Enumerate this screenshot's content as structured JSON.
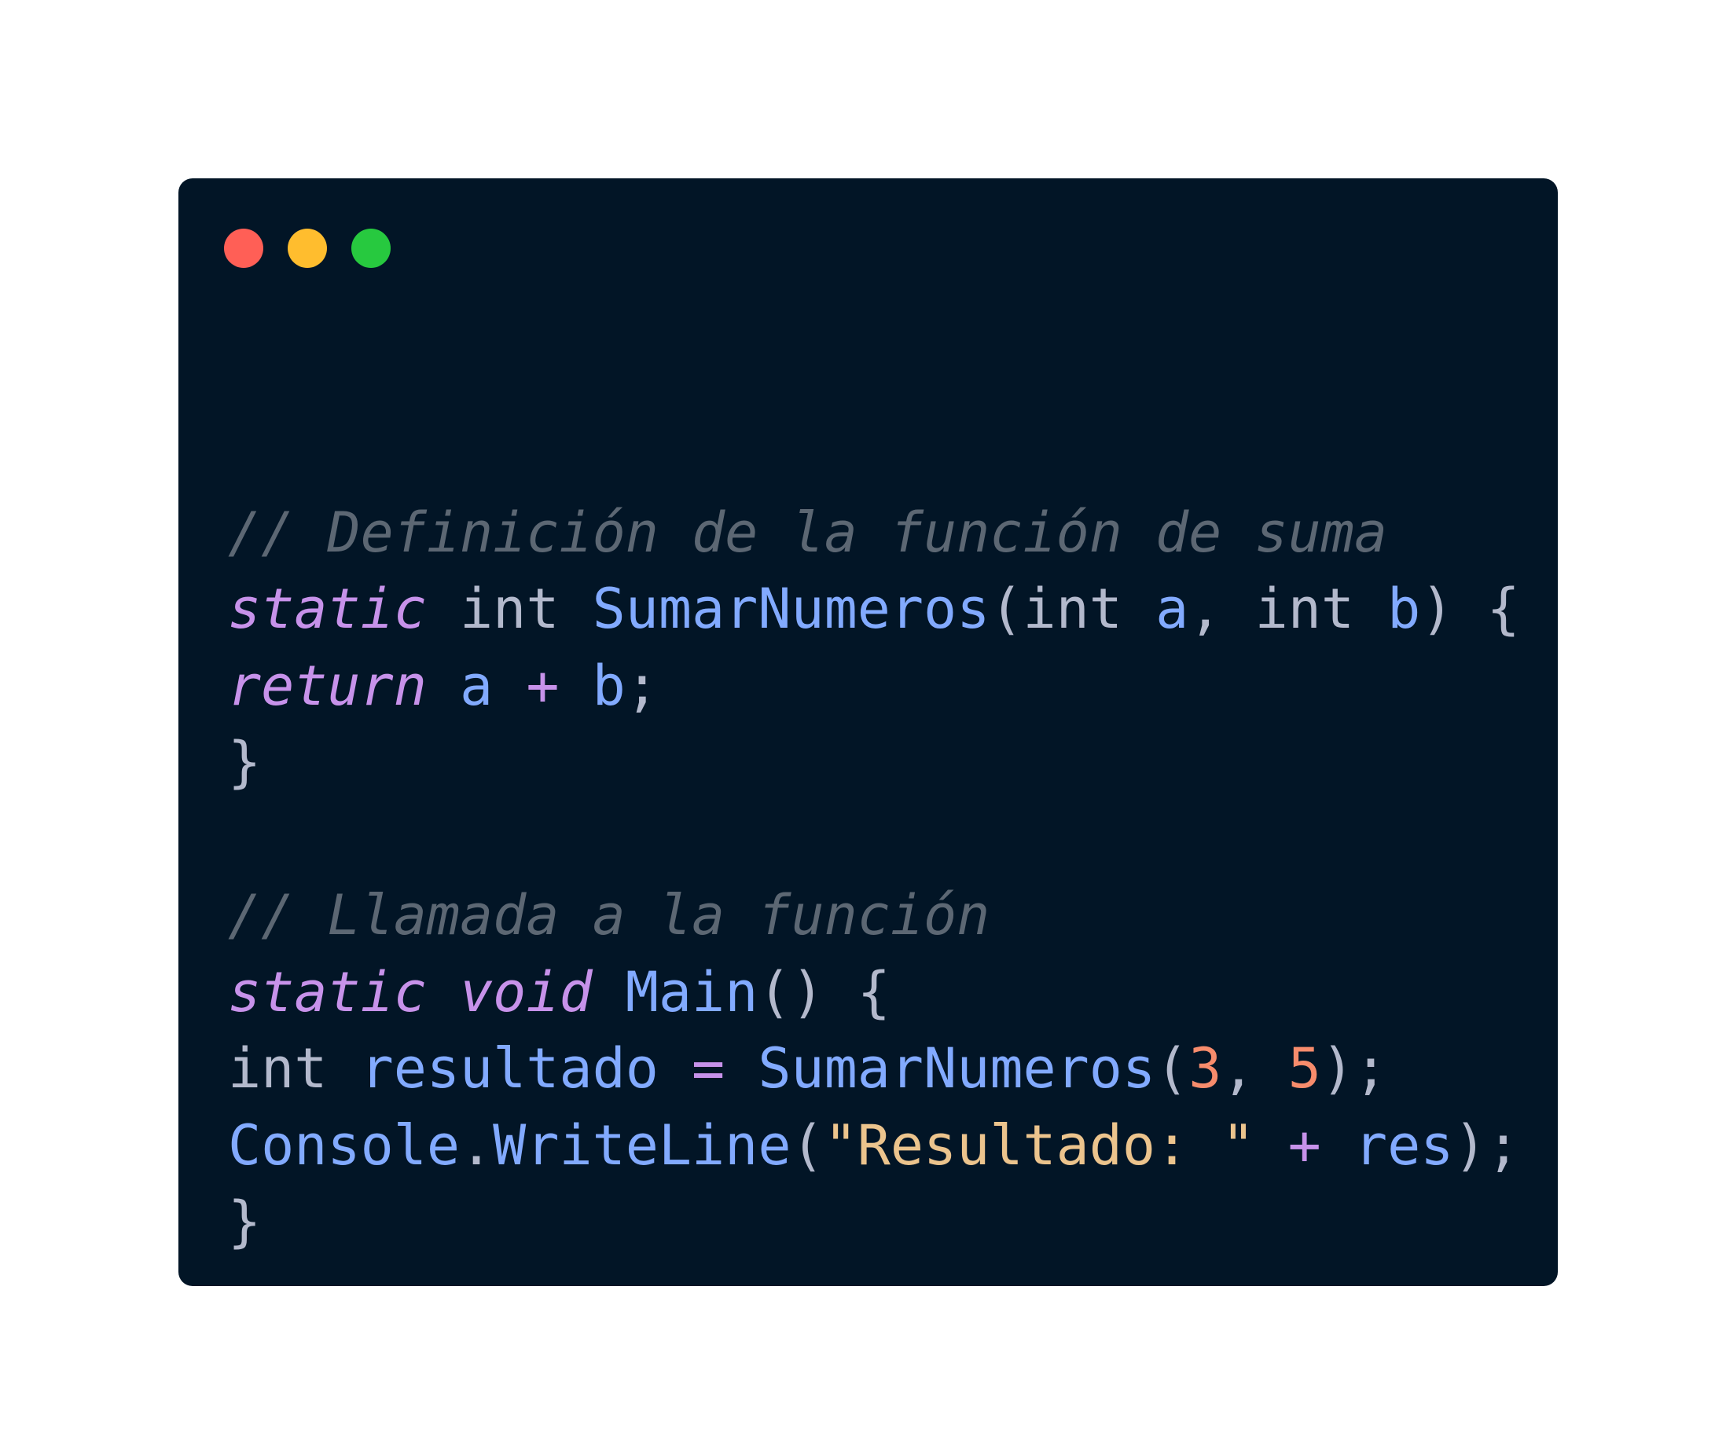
{
  "window": {
    "background": "#021526",
    "traffic_lights": [
      {
        "name": "close",
        "color": "#ff5f56"
      },
      {
        "name": "minimize",
        "color": "#ffbd2e"
      },
      {
        "name": "maximize",
        "color": "#27c93f"
      }
    ]
  },
  "theme": {
    "comment": "#5c6773",
    "keyword": "#c792ea",
    "type": "#b3b9cc",
    "function": "#82aaff",
    "param": "#82aaff",
    "punct": "#b3b9cc",
    "operator": "#c792ea",
    "number": "#f78c6c",
    "string": "#ecc48d",
    "plain": "#b3b9cc"
  },
  "code": {
    "lines": [
      [],
      [
        {
          "t": "// Definición de la función de suma",
          "k": "comment"
        }
      ],
      [
        {
          "t": "static",
          "k": "keyword"
        },
        {
          "t": " ",
          "k": "plain"
        },
        {
          "t": "int",
          "k": "type"
        },
        {
          "t": " ",
          "k": "plain"
        },
        {
          "t": "SumarNumeros",
          "k": "function"
        },
        {
          "t": "(",
          "k": "punct"
        },
        {
          "t": "int",
          "k": "type"
        },
        {
          "t": " ",
          "k": "plain"
        },
        {
          "t": "a",
          "k": "param"
        },
        {
          "t": ", ",
          "k": "punct"
        },
        {
          "t": "int",
          "k": "type"
        },
        {
          "t": " ",
          "k": "plain"
        },
        {
          "t": "b",
          "k": "param"
        },
        {
          "t": ") {",
          "k": "punct"
        }
      ],
      [
        {
          "t": "return",
          "k": "keyword"
        },
        {
          "t": " ",
          "k": "plain"
        },
        {
          "t": "a",
          "k": "param"
        },
        {
          "t": " ",
          "k": "plain"
        },
        {
          "t": "+",
          "k": "operator"
        },
        {
          "t": " ",
          "k": "plain"
        },
        {
          "t": "b",
          "k": "param"
        },
        {
          "t": ";",
          "k": "punct"
        }
      ],
      [
        {
          "t": "}",
          "k": "punct"
        }
      ],
      [],
      [
        {
          "t": "// Llamada a la función",
          "k": "comment"
        }
      ],
      [
        {
          "t": "static",
          "k": "keyword"
        },
        {
          "t": " ",
          "k": "plain"
        },
        {
          "t": "void",
          "k": "keyword"
        },
        {
          "t": " ",
          "k": "plain"
        },
        {
          "t": "Main",
          "k": "function"
        },
        {
          "t": "() {",
          "k": "punct"
        }
      ],
      [
        {
          "t": "int",
          "k": "type"
        },
        {
          "t": " ",
          "k": "plain"
        },
        {
          "t": "resultado",
          "k": "param"
        },
        {
          "t": " ",
          "k": "plain"
        },
        {
          "t": "=",
          "k": "operator"
        },
        {
          "t": " ",
          "k": "plain"
        },
        {
          "t": "SumarNumeros",
          "k": "function"
        },
        {
          "t": "(",
          "k": "punct"
        },
        {
          "t": "3",
          "k": "number"
        },
        {
          "t": ", ",
          "k": "punct"
        },
        {
          "t": "5",
          "k": "number"
        },
        {
          "t": ");",
          "k": "punct"
        }
      ],
      [
        {
          "t": "Console",
          "k": "function"
        },
        {
          "t": ".",
          "k": "punct"
        },
        {
          "t": "WriteLine",
          "k": "function"
        },
        {
          "t": "(",
          "k": "punct"
        },
        {
          "t": "\"Resultado: \"",
          "k": "string"
        },
        {
          "t": " ",
          "k": "plain"
        },
        {
          "t": "+",
          "k": "operator"
        },
        {
          "t": " ",
          "k": "plain"
        },
        {
          "t": "res",
          "k": "param"
        },
        {
          "t": ");",
          "k": "punct"
        }
      ],
      [
        {
          "t": "}",
          "k": "punct"
        }
      ]
    ]
  }
}
